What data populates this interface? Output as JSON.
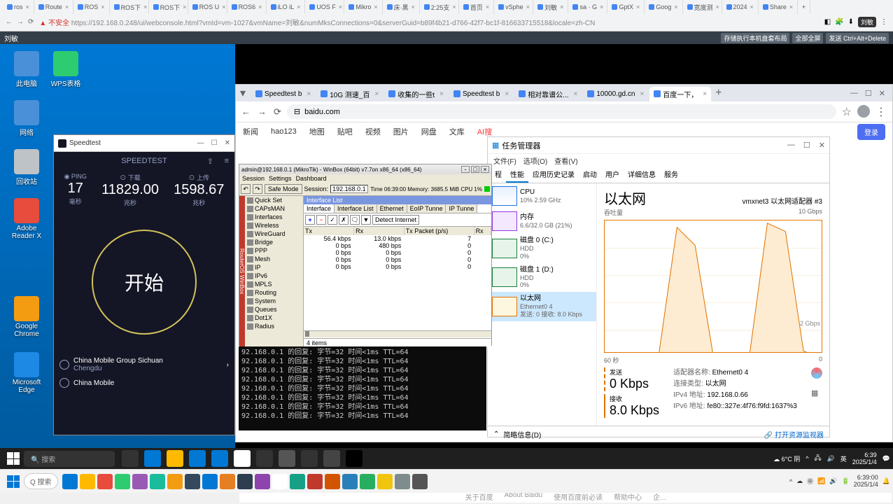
{
  "outer_browser": {
    "tabs": [
      "ros",
      "Route",
      "ROS",
      "ROS下",
      "ROS下",
      "ROS U",
      "ROS6",
      "iLO iL",
      "UOS F",
      "Mikro",
      "床·黑",
      "2:25支",
      "首页",
      "vSphe",
      "刘敏",
      "sa · G",
      "GptX",
      "Goog",
      "宽度测",
      "2024",
      "Share"
    ],
    "warning": "不安全",
    "url": "https://192.168.0.248/ui/webconsole.html?vmId=vm-1027&vmName=刘敏&numMksConnections=0&serverGuid=b89f4b21-d766-42f7-bc1f-816633715518&locale=zh-CN",
    "ext_badge": "刘敏"
  },
  "vsphere": {
    "title": "刘敏",
    "buttons": [
      "存储执行本机盘套布局",
      "全部全屏",
      "发送 Ctrl+Alt+Delete"
    ]
  },
  "desktop_icons": [
    {
      "label": "此电脑",
      "color": "#4a90d9"
    },
    {
      "label": "WPS表格",
      "color": "#2ecc71"
    },
    {
      "label": "网络",
      "color": "#4a90d9"
    },
    {
      "label": "回收站",
      "color": "#bdc3c7"
    },
    {
      "label": "Adobe Reader X",
      "color": "#e74c3c"
    },
    {
      "label": "Google Chrome",
      "color": "#f39c12"
    },
    {
      "label": "Microsoft Edge",
      "color": "#1e88e5"
    }
  ],
  "speedtest": {
    "title": "Speedtest",
    "brand": "SPEEDTEST",
    "ping_label": "PING",
    "ping_val": "17",
    "ping_unit": "毫秒",
    "dl_label": "下载",
    "dl_val": "11829.00",
    "dl_unit": "兆秒",
    "ul_label": "上传",
    "ul_val": "1598.67",
    "ul_unit": "兆秒",
    "go": "开始",
    "isp1": "China Mobile Group Sichuan",
    "isp1_loc": "Chengdu",
    "isp2": "China Mobile"
  },
  "inner_chrome": {
    "tabs": [
      {
        "label": "Speedtest b",
        "active": false
      },
      {
        "label": "10G 测速_百",
        "active": false
      },
      {
        "label": "收集的一些t",
        "active": false
      },
      {
        "label": "Speedtest b",
        "active": false
      },
      {
        "label": "相对靠谱公...",
        "active": false
      },
      {
        "label": "10000.gd.cn",
        "active": false
      },
      {
        "label": "百度一下，",
        "active": true
      }
    ],
    "url": "baidu.com"
  },
  "baidu": {
    "nav": [
      "新闻",
      "hao123",
      "地图",
      "贴吧",
      "视频",
      "图片",
      "网盘",
      "文库",
      "AI搜"
    ],
    "login": "登录",
    "footer": [
      "关于百度",
      "About Baidu",
      "使用百度前必读",
      "帮助中心",
      "企..."
    ]
  },
  "taskmgr": {
    "title": "任务管理器",
    "menu": [
      "文件(F)",
      "选项(O)",
      "查看(V)"
    ],
    "tabs": [
      "程",
      "性能",
      "应用历史记录",
      "启动",
      "用户",
      "详细信息",
      "服务"
    ],
    "left": [
      {
        "name": "CPU",
        "detail": "10% 2.59 GHz",
        "type": "cpu"
      },
      {
        "name": "内存",
        "detail": "6.6/32.0 GB (21%)",
        "type": "mem"
      },
      {
        "name": "磁盘 0 (C:)",
        "detail": "HDD\n0%",
        "type": "disk"
      },
      {
        "name": "磁盘 1 (D:)",
        "detail": "HDD\n0%",
        "type": "disk"
      },
      {
        "name": "以太网",
        "detail": "Ethernet0 4\n发送: 0 接收: 8.0 Kbps",
        "type": "net",
        "selected": true
      }
    ],
    "right": {
      "title": "以太网",
      "adapter": "vmxnet3 以太网适配器 #3",
      "throughput_label": "吞吐量",
      "max": "10 Gbps",
      "tick": "2 Gbps",
      "xlabel": "60 秒",
      "send_label": "发送",
      "send_val": "0 Kbps",
      "recv_label": "接收",
      "recv_val": "8.0 Kbps",
      "details": [
        [
          "适配器名称:",
          "Ethernet0 4"
        ],
        [
          "连接类型:",
          "以太网"
        ],
        [
          "IPv4 地址:",
          "192.168.0.66"
        ],
        [
          "IPv6 地址:",
          "fe80::327e:4f76:f9fd:1637%3"
        ]
      ]
    },
    "footer": {
      "less": "简略信息(D)",
      "monitor": "打开资源监视器"
    }
  },
  "chart_data": {
    "type": "area",
    "title": "以太网 吞吐量",
    "x": [
      0,
      5,
      10,
      15,
      20,
      25,
      30,
      35,
      40,
      45,
      50,
      55,
      60
    ],
    "send_values": [
      0,
      0,
      0,
      0,
      0,
      0,
      0,
      0,
      0,
      0,
      0,
      0,
      0
    ],
    "recv_values": [
      0.008,
      0.008,
      0.1,
      0.3,
      9.5,
      8.2,
      0.2,
      0.05,
      0.1,
      9.8,
      9.2,
      0.5,
      0.008
    ],
    "ylim": [
      0,
      10
    ],
    "yunit": "Gbps",
    "xlabel": "60 秒"
  },
  "winbox": {
    "title": "admin@192.168.0.1 (MikroTik) - WinBox (64bit) v7.7on x86_64 (x86_64)",
    "menu": [
      "Session",
      "Settings",
      "Dashboard"
    ],
    "safe_mode": "Safe Mode",
    "session_label": "Session:",
    "session_ip": "192.168.0.1",
    "time": "Time 06:39:00 Memory: 3685.5 MiB CPU 1%",
    "side": [
      "Quick Set",
      "CAPsMAN",
      "Interfaces",
      "Wireless",
      "WireGuard",
      "Bridge",
      "PPP",
      "Mesh",
      "IP",
      "IPv6",
      "MPLS",
      "Routing",
      "System",
      "Queues",
      "Dot1X",
      "Radius"
    ],
    "iface_title": "Interface List",
    "iface_tabs": [
      "Interface",
      "Interface List",
      "Ethernet",
      "EoIP Tunne",
      "IP Tunne"
    ],
    "iface_tb_detect": "Detect Internet",
    "cols": [
      "Tx",
      "Rx",
      "Tx Packet (p/s)",
      "Rx"
    ],
    "rows": [
      [
        "56.4 kbps",
        "13.0 kbps",
        "7"
      ],
      [
        "0 bps",
        "480 bps",
        "0"
      ],
      [
        "0 bps",
        "0 bps",
        "0"
      ],
      [
        "0 bps",
        "0 bps",
        "0"
      ],
      [
        "0 bps",
        "0 bps",
        "0"
      ]
    ],
    "status": "4 items"
  },
  "cmd_lines": [
    "92.168.0.1 的回复: 字节=32 时间<1ms TTL=64",
    "92.168.0.1 的回复: 字节=32 时间<1ms TTL=64",
    "92.168.0.1 的回复: 字节=32 时间<1ms TTL=64",
    "92.168.0.1 的回复: 字节=32 时间<1ms TTL=64",
    "92.168.0.1 的回复: 字节=32 时间<1ms TTL=64",
    "92.168.0.1 的回复: 字节=32 时间<1ms TTL=64",
    "92.168.0.1 的回复: 字节=32 时间<1ms TTL=64",
    "92.168.0.1 的回复: 字节=32 时间<1ms TTL=64"
  ],
  "taskbar1": {
    "search": "搜索",
    "weather": "6°C 阴",
    "ime": "英",
    "time": "6:39",
    "date": "2025/1/4"
  },
  "taskbar2": {
    "search": "Q 搜索",
    "time": "6:39:00",
    "date": "2025/1/4"
  }
}
